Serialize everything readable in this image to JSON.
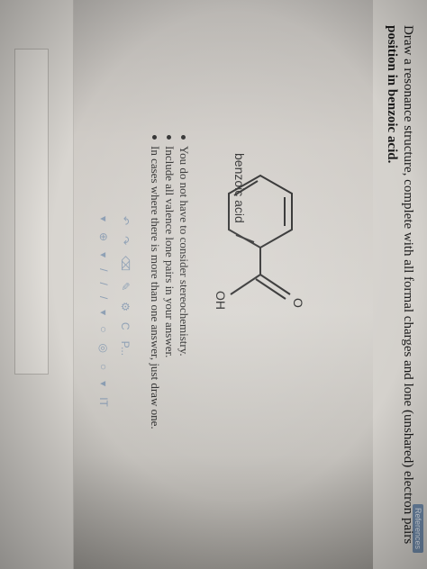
{
  "question": {
    "line1": "Draw a resonance structure, complete with all formal charges and lone (unshared) electron pairs",
    "line2": "position in benzoic acid."
  },
  "badge": "References",
  "molecule": {
    "carbonyl_O": "O",
    "hydroxyl": "OH",
    "name": "benzoic acid"
  },
  "instructions": [
    "You do not have to consider stereochemistry.",
    "Include all valence lone pairs in your answer.",
    "In cases where there is more than one answer, just draw one."
  ],
  "toolbar": {
    "row1": [
      "↶",
      "↷",
      "⌫",
      "✎",
      "⚙",
      "C",
      "P..."
    ],
    "row2": [
      "▾",
      "⊕",
      "▾",
      "/",
      "/",
      "/",
      "▾",
      "○",
      "◎",
      "○",
      "▾",
      "IT"
    ]
  }
}
